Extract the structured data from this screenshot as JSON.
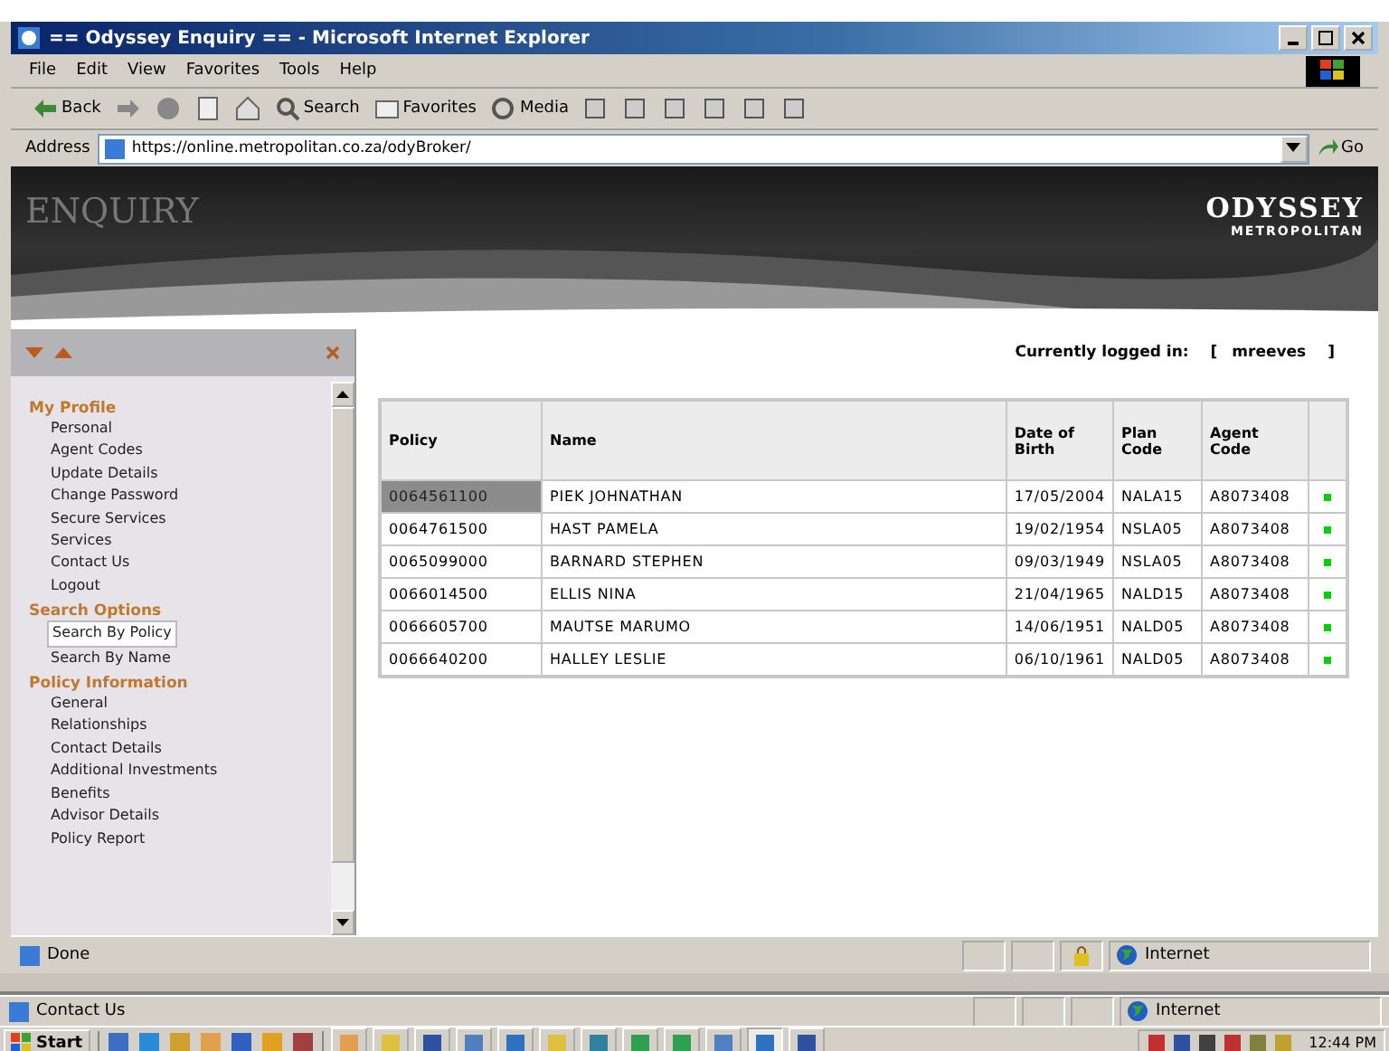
{
  "window": {
    "title": "== Odyssey Enquiry == - Microsoft Internet Explorer"
  },
  "menu": [
    "File",
    "Edit",
    "View",
    "Favorites",
    "Tools",
    "Help"
  ],
  "toolbar": [
    {
      "kind": "back",
      "label": "Back"
    },
    {
      "kind": "forward"
    },
    {
      "kind": "stop"
    },
    {
      "kind": "refresh"
    },
    {
      "kind": "home"
    },
    {
      "kind": "search",
      "label": "Search"
    },
    {
      "kind": "favorites",
      "label": "Favorites"
    },
    {
      "kind": "media",
      "label": "Media"
    },
    {
      "kind": "history"
    },
    {
      "kind": "mail"
    },
    {
      "kind": "print"
    },
    {
      "kind": "edit"
    },
    {
      "kind": "discuss"
    },
    {
      "kind": "messenger"
    }
  ],
  "address": {
    "label": "Address",
    "value": "https://online.metropolitan.co.za/odyBroker/",
    "go": "Go"
  },
  "banner": {
    "title": "ENQUIRY",
    "logo": "ODYSSEY",
    "logo_sub": "METROPOLITAN"
  },
  "sidebar": {
    "sections": [
      {
        "title": "My Profile",
        "items": [
          {
            "label": "Personal",
            "selected": false
          },
          {
            "label": "Agent Codes",
            "selected": false
          },
          {
            "label": "Update Details",
            "selected": false
          },
          {
            "label": "Change Password",
            "selected": false
          },
          {
            "label": "Secure Services",
            "selected": false
          },
          {
            "label": "Services",
            "selected": false
          },
          {
            "label": "Contact Us",
            "selected": false
          },
          {
            "label": "Logout",
            "selected": false
          }
        ]
      },
      {
        "title": "Search Options",
        "items": [
          {
            "label": "Search By Policy",
            "selected": true
          },
          {
            "label": "Search By Name",
            "selected": false
          }
        ]
      },
      {
        "title": "Policy Information",
        "items": [
          {
            "label": "General",
            "selected": false
          },
          {
            "label": "Relationships",
            "selected": false
          },
          {
            "label": "Contact Details",
            "selected": false
          },
          {
            "label": "Additional Investments",
            "selected": false
          },
          {
            "label": "Benefits",
            "selected": false
          },
          {
            "label": "Advisor Details",
            "selected": false
          },
          {
            "label": "Policy Report",
            "selected": false
          }
        ]
      }
    ]
  },
  "login": {
    "label": "Currently logged in:",
    "open": "[",
    "user": "mreeves",
    "close": "]"
  },
  "table": {
    "columns": [
      "Policy",
      "Name",
      "Date of Birth",
      "Plan Code",
      "Agent Code"
    ],
    "rows": [
      {
        "policy": "0064561100",
        "name": "PIEK JOHNATHAN",
        "dob": "17/05/2004",
        "plan": "NALA15",
        "agent": "A8073408",
        "selected": true
      },
      {
        "policy": "0064761500",
        "name": "HAST PAMELA",
        "dob": "19/02/1954",
        "plan": "NSLA05",
        "agent": "A8073408",
        "selected": false
      },
      {
        "policy": "0065099000",
        "name": "BARNARD STEPHEN",
        "dob": "09/03/1949",
        "plan": "NSLA05",
        "agent": "A8073408",
        "selected": false
      },
      {
        "policy": "0066014500",
        "name": "ELLIS NINA",
        "dob": "21/04/1965",
        "plan": "NALD15",
        "agent": "A8073408",
        "selected": false
      },
      {
        "policy": "0066605700",
        "name": "MAUTSE MARUMO",
        "dob": "14/06/1951",
        "plan": "NALD05",
        "agent": "A8073408",
        "selected": false
      },
      {
        "policy": "0066640200",
        "name": "HALLEY LESLIE",
        "dob": "06/10/1961",
        "plan": "NALD05",
        "agent": "A8073408",
        "selected": false
      }
    ]
  },
  "status_bar": {
    "text": "Done",
    "zone": "Internet"
  },
  "status_bar_2": {
    "text": "Contact Us",
    "zone": "Internet"
  },
  "taskbar": {
    "start": "Start",
    "clock": "12:44 PM"
  }
}
